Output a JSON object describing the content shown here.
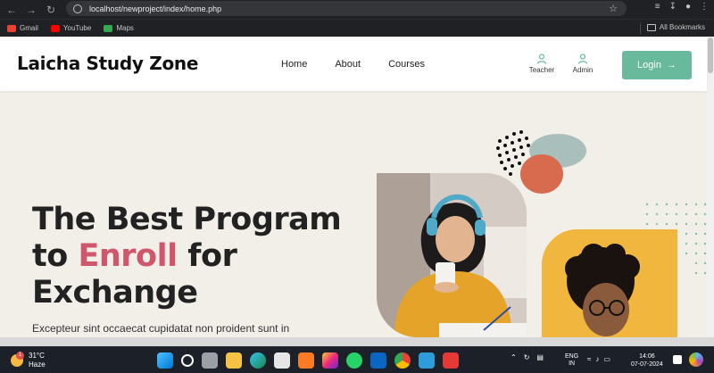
{
  "browser": {
    "url": "localhost/newproject/index/home.php",
    "bookmarks": [
      {
        "label": "Gmail",
        "color": "#ea4335"
      },
      {
        "label": "YouTube",
        "color": "#ff0000"
      },
      {
        "label": "Maps",
        "color": "#34a853"
      }
    ],
    "all_bookmarks": "All Bookmarks"
  },
  "site": {
    "logo": "Laicha Study Zone",
    "menu": [
      "Home",
      "About",
      "Courses"
    ],
    "roles": [
      {
        "label": "Teacher",
        "icon": "person-icon"
      },
      {
        "label": "Admin",
        "icon": "person-icon"
      }
    ],
    "login_label": "Login",
    "accent_color": "#69b99d",
    "highlight_color": "#d0566b"
  },
  "hero": {
    "line1": "The Best Program",
    "line2_pre": "to ",
    "line2_accent": "Enroll",
    "line2_post": " for",
    "line3": "Exchange",
    "subtitle": "Excepteur sint occaecat cupidatat non proident sunt in"
  },
  "taskbar": {
    "temperature": "31°C",
    "condition": "Haze",
    "weather_badge": "1",
    "lang_top": "ENG",
    "lang_bottom": "IN",
    "time": "14:06",
    "date": "07-07-2024",
    "icons": [
      "windows-icon",
      "search-icon",
      "task-view-icon",
      "file-explorer-icon",
      "edge-icon",
      "store-icon",
      "xampp-icon",
      "instagram-icon",
      "whatsapp-icon",
      "linkedin-icon",
      "chrome-icon",
      "vscode-icon",
      "app-icon"
    ]
  }
}
